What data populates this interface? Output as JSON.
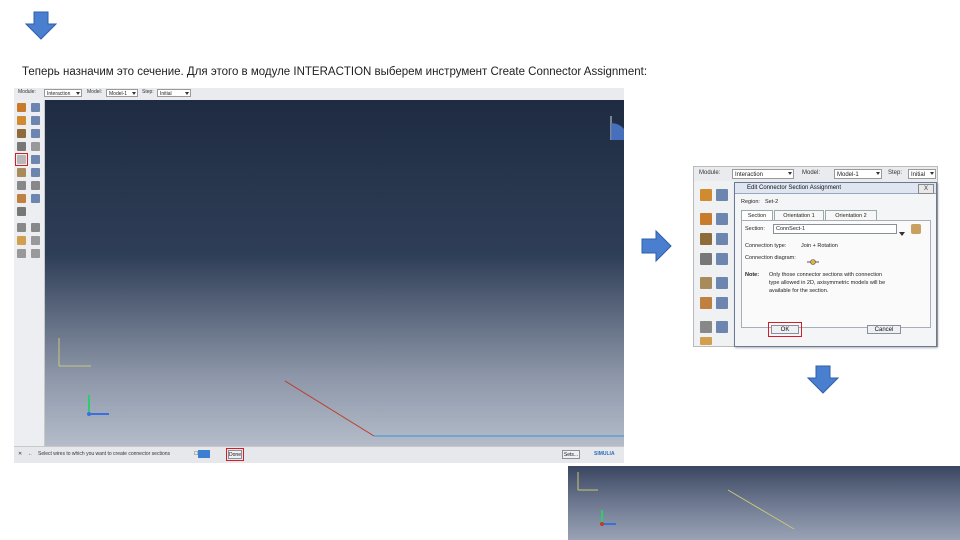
{
  "caption": "Теперь назначим это сечение. Для этого в модуле INTERACTION выберем инструмент Create Connector Assignment:",
  "context_bar": {
    "module_label": "Module:",
    "module_value": "Interaction",
    "model_label": "Model:",
    "model_value": "Model-1",
    "step_label": "Step:",
    "step_value": "Initial"
  },
  "status_bar": {
    "prompt": "Select wires to which you want to create connector sections",
    "done_label": "Done",
    "set_label": "Sets...",
    "brand": "SIMULIA"
  },
  "dialog_panel": {
    "module_label": "Module:",
    "module_value": "Interaction",
    "model_label": "Model:",
    "model_value": "Model-1",
    "step_label": "Step:",
    "step_value": "Initial",
    "title": "Edit Connector Section Assignment",
    "close_label": "X",
    "region_label": "Region:",
    "region_value": "Set-2",
    "tabs": [
      "Section",
      "Orientation 1",
      "Orientation 2"
    ],
    "section_label": "Section:",
    "section_value": "ConnSect-1",
    "connection_type_label": "Connection type:",
    "connection_type_value": "Join + Rotation",
    "connection_diagram_label": "Connection diagram:",
    "note_label": "Note:",
    "note_line1": "Only those connector sections with connection",
    "note_line2": "type allowed in 2D, axisymmetric models will be",
    "note_line3": "available for the section.",
    "ok_label": "OK",
    "cancel_label": "Cancel"
  },
  "colors": {
    "arrow_fill": "#4a7fd0",
    "highlight": "#d21f26",
    "wire_red": "#c0392b",
    "wire_blue": "#3b8fd8"
  }
}
